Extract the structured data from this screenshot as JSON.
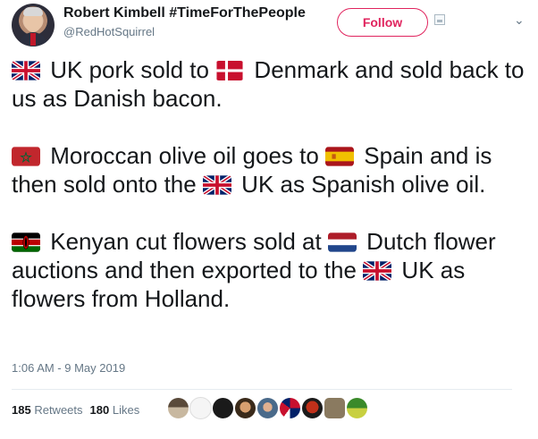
{
  "author": {
    "name": "Robert Kimbell #TimeForThePeople",
    "handle": "@RedHotSquirrel"
  },
  "header": {
    "follow_label": "Follow"
  },
  "tweet": {
    "paragraphs": [
      {
        "parts": [
          {
            "flag": "uk"
          },
          {
            "text": " UK pork sold to "
          },
          {
            "flag": "denmark"
          },
          {
            "text": " Denmark and sold back to us as Danish bacon."
          }
        ]
      },
      {
        "parts": [
          {
            "flag": "morocco"
          },
          {
            "text": " Moroccan olive oil goes to "
          },
          {
            "flag": "spain"
          },
          {
            "text": " Spain and is then sold onto the "
          },
          {
            "flag": "uk"
          },
          {
            "text": " UK as Spanish olive oil."
          }
        ]
      },
      {
        "parts": [
          {
            "flag": "kenya"
          },
          {
            "text": " Kenyan cut flowers sold at "
          },
          {
            "flag": "netherlands"
          },
          {
            "text": " Dutch flower auctions and then exported to the "
          },
          {
            "flag": "uk"
          },
          {
            "text": " UK as flowers from Holland."
          }
        ]
      }
    ],
    "timestamp": "1:06 AM - 9 May 2019"
  },
  "stats": {
    "retweets_count": "185",
    "retweets_label": "Retweets",
    "likes_count": "180",
    "likes_label": "Likes"
  },
  "likers_count": 9,
  "colors": {
    "follow_accent": "#e0245e",
    "secondary_text": "#657786",
    "primary_text": "#14171a"
  }
}
